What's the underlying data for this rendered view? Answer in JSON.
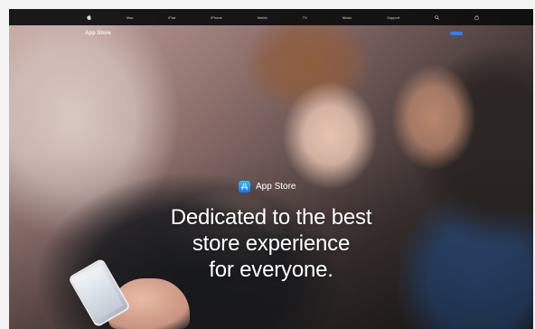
{
  "globalnav": {
    "items": [
      "Mac",
      "iPad",
      "iPhone",
      "Watch",
      "TV",
      "Music",
      "Support"
    ]
  },
  "localnav": {
    "title": "App Store",
    "link_label": "",
    "cta_label": ""
  },
  "hero": {
    "badge_label": "App Store",
    "headline_lines": [
      "Dedicated to the best",
      "store experience",
      "for everyone."
    ]
  },
  "colors": {
    "cta": "#2f7ff5",
    "nav_background": "#0c0c0c",
    "text": "#ffffff"
  }
}
